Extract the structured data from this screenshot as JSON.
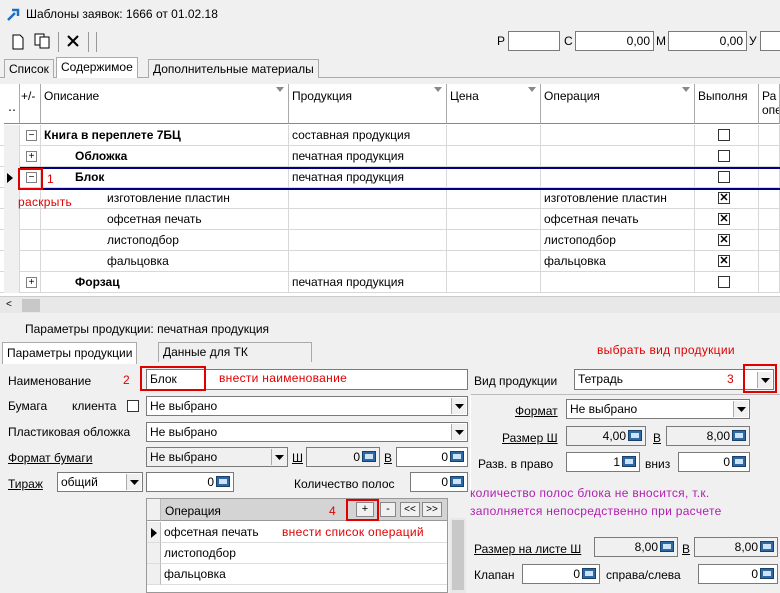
{
  "window": {
    "title": "Шаблоны заявок: 1666 от 01.02.18"
  },
  "toolbar": {
    "p_label": "Р",
    "p_value": "",
    "c_label": "С",
    "c_value": "0,00",
    "m_label": "М",
    "m_value": "0,00",
    "u_label": "У",
    "u_value": ""
  },
  "tabs": [
    "Список",
    "Содержимое",
    "Дополнительные материалы"
  ],
  "grid": {
    "columns": [
      "+/-",
      "Описание",
      "Продукция",
      "Цена",
      "Операция",
      "Выполня",
      "Ра"
    ],
    "sub_column": "опе",
    "rows": [
      {
        "expander": "−",
        "description": "Книга в переплете 7БЦ",
        "product": "составная продукция",
        "operation": "",
        "checked": false
      },
      {
        "expander": "+",
        "description": "Обложка",
        "product": "печатная продукция",
        "operation": "",
        "checked": false
      },
      {
        "expander": "−",
        "description": "Блок",
        "product": "печатная продукция",
        "operation": "",
        "checked": false
      },
      {
        "expander": "",
        "description": "изготовление пластин",
        "product": "",
        "operation": "изготовление пластин",
        "checked": true
      },
      {
        "expander": "",
        "description": "офсетная печать",
        "product": "",
        "operation": "офсетная печать",
        "checked": true
      },
      {
        "expander": "",
        "description": "листоподбор",
        "product": "",
        "operation": "листоподбор",
        "checked": true
      },
      {
        "expander": "",
        "description": "фальцовка",
        "product": "",
        "operation": "фальцовка",
        "checked": true
      },
      {
        "expander": "+",
        "description": "Форзац",
        "product": "печатная продукция",
        "operation": "",
        "checked": false
      }
    ]
  },
  "params": {
    "title": "Параметры продукции: печатная продукция",
    "tabs": [
      "Параметры продукции",
      "Данные для ТК"
    ],
    "name_label": "Наименование",
    "name_value": "Блок",
    "paper_label": "Бумага",
    "client_label": "клиента",
    "paper_value": "Не выбрано",
    "plastic_label": "Пластиковая обложка",
    "plastic_value": "Не выбрано",
    "paper_format_label": "Формат бумаги",
    "paper_format_value": "Не выбрано",
    "sh_label": "Ш",
    "sh_value": "0",
    "v_label": "В",
    "v_value": "0",
    "tirage_label": "Тираж",
    "tirage_type": "общий",
    "tirage_value": "0",
    "pages_label": "Количество полос",
    "pages_value": "0",
    "product_type_label": "Вид продукции",
    "product_type_value": "Тетрадь",
    "format_label": "Формат",
    "format_value": "Не выбрано",
    "size_label": "Размер Ш",
    "size_w": "4,00",
    "size_v_label": "В",
    "size_h": "8,00",
    "spread_label": "Разв. в право",
    "spread_value": "1",
    "down_label": "вниз",
    "down_value": "0",
    "sheet_size_label": "Размер на листе Ш",
    "sheet_w": "8,00",
    "sheet_v_label": "В",
    "sheet_h": "8,00",
    "valve_label": "Клапан",
    "valve_value": "0",
    "side_label": "справа/слева",
    "side_value": "0"
  },
  "ops": {
    "header": "Операция",
    "buttons": [
      "+",
      "-",
      "<<",
      ">>"
    ],
    "items": [
      "офсетная печать",
      "листоподбор",
      "фальцовка"
    ]
  },
  "annotations": {
    "a1": "1",
    "raskryt": "раскрыть",
    "a2": "2",
    "name_hint": "внести наименование",
    "a3": "3",
    "type_hint": "выбрать вид продукции",
    "a4": "4",
    "ops_hint": "внести список операций",
    "note1": "количество полос блока не вносится, т.к.",
    "note2": "заполняется  непосредственно при расчете"
  },
  "colors": {
    "annotation": "#e00000",
    "note": "#b01fb0",
    "selection": "#000080",
    "calc_icon": "#2b6aa6"
  }
}
